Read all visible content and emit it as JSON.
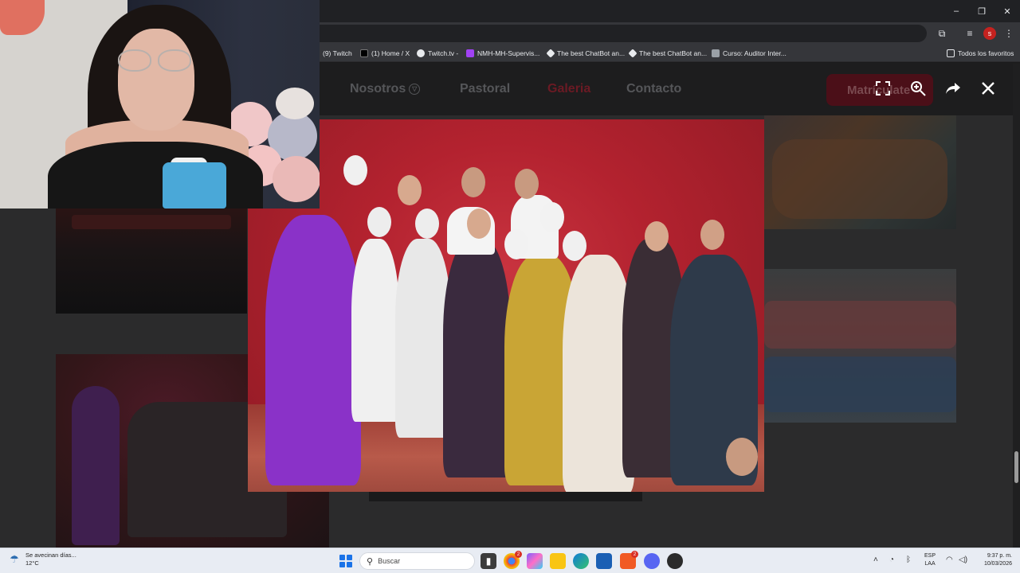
{
  "browser": {
    "window_controls": {
      "minimize": "–",
      "restore": "❐",
      "close": "✕"
    },
    "bookmarks": [
      {
        "label": "(9) Twitch",
        "icon": "twitch-icon",
        "color": "#9146ff"
      },
      {
        "label": "(1) Home / X",
        "icon": "x-icon",
        "color": "#000000"
      },
      {
        "label": "Twitch.tv -",
        "icon": "globe-icon",
        "color": "#9146ff"
      },
      {
        "label": "NMH-MH-Supervis...",
        "icon": "doc-icon",
        "color": "#a142f4"
      },
      {
        "label": "The best ChatBot an...",
        "icon": "chatbot-icon",
        "color": "#e8eaed"
      },
      {
        "label": "The best ChatBot an...",
        "icon": "chatbot-icon",
        "color": "#e8eaed"
      },
      {
        "label": "Curso: Auditor Inter...",
        "icon": "course-icon",
        "color": "#9aa0a6"
      }
    ],
    "all_bookmarks_label": "Todos los favoritos"
  },
  "site": {
    "nav": {
      "nosotros": "Nosotros",
      "pastoral": "Pastoral",
      "galeria": "Galeria",
      "contacto": "Contacto",
      "cta": "Matrículate"
    }
  },
  "taskbar": {
    "weather_line1": "Se avecinan días...",
    "weather_line2": "12°C",
    "search_placeholder": "Buscar",
    "lang_line1": "ESP",
    "lang_line2": "LAA",
    "time": "9:37 p. m.",
    "date": "10/03/2026",
    "apps": [
      {
        "name": "task-view-icon",
        "color": "#3c3c3c"
      },
      {
        "name": "chrome-icon",
        "color": "#ea4335",
        "badge": "2"
      },
      {
        "name": "copilot-icon",
        "color": "#7b61ff"
      },
      {
        "name": "file-explorer-icon",
        "color": "#f9c513"
      },
      {
        "name": "edge-icon",
        "color": "#0f7bd8"
      },
      {
        "name": "store-icon",
        "color": "#1a5fb4"
      },
      {
        "name": "brave-icon",
        "color": "#f15a24",
        "badge": "2"
      },
      {
        "name": "discord-icon",
        "color": "#5865f2"
      },
      {
        "name": "app-icon",
        "color": "#2b2b2b"
      }
    ]
  },
  "colors": {
    "accent_red": "#c8333f",
    "cta_dim": "#4b0f18"
  }
}
